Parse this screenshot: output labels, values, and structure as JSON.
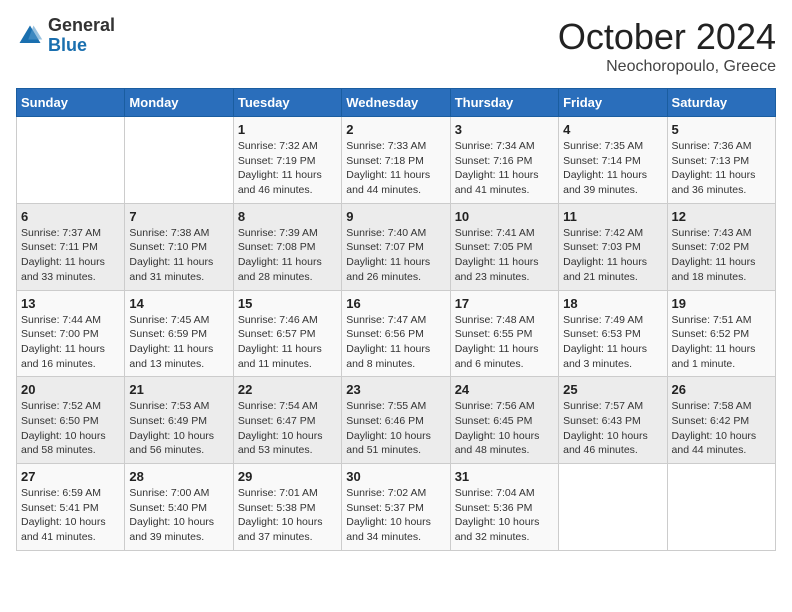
{
  "header": {
    "logo_general": "General",
    "logo_blue": "Blue",
    "month": "October 2024",
    "location": "Neochoropoulo, Greece"
  },
  "weekdays": [
    "Sunday",
    "Monday",
    "Tuesday",
    "Wednesday",
    "Thursday",
    "Friday",
    "Saturday"
  ],
  "weeks": [
    [
      {
        "day": "",
        "info": ""
      },
      {
        "day": "",
        "info": ""
      },
      {
        "day": "1",
        "info": "Sunrise: 7:32 AM\nSunset: 7:19 PM\nDaylight: 11 hours and 46 minutes."
      },
      {
        "day": "2",
        "info": "Sunrise: 7:33 AM\nSunset: 7:18 PM\nDaylight: 11 hours and 44 minutes."
      },
      {
        "day": "3",
        "info": "Sunrise: 7:34 AM\nSunset: 7:16 PM\nDaylight: 11 hours and 41 minutes."
      },
      {
        "day": "4",
        "info": "Sunrise: 7:35 AM\nSunset: 7:14 PM\nDaylight: 11 hours and 39 minutes."
      },
      {
        "day": "5",
        "info": "Sunrise: 7:36 AM\nSunset: 7:13 PM\nDaylight: 11 hours and 36 minutes."
      }
    ],
    [
      {
        "day": "6",
        "info": "Sunrise: 7:37 AM\nSunset: 7:11 PM\nDaylight: 11 hours and 33 minutes."
      },
      {
        "day": "7",
        "info": "Sunrise: 7:38 AM\nSunset: 7:10 PM\nDaylight: 11 hours and 31 minutes."
      },
      {
        "day": "8",
        "info": "Sunrise: 7:39 AM\nSunset: 7:08 PM\nDaylight: 11 hours and 28 minutes."
      },
      {
        "day": "9",
        "info": "Sunrise: 7:40 AM\nSunset: 7:07 PM\nDaylight: 11 hours and 26 minutes."
      },
      {
        "day": "10",
        "info": "Sunrise: 7:41 AM\nSunset: 7:05 PM\nDaylight: 11 hours and 23 minutes."
      },
      {
        "day": "11",
        "info": "Sunrise: 7:42 AM\nSunset: 7:03 PM\nDaylight: 11 hours and 21 minutes."
      },
      {
        "day": "12",
        "info": "Sunrise: 7:43 AM\nSunset: 7:02 PM\nDaylight: 11 hours and 18 minutes."
      }
    ],
    [
      {
        "day": "13",
        "info": "Sunrise: 7:44 AM\nSunset: 7:00 PM\nDaylight: 11 hours and 16 minutes."
      },
      {
        "day": "14",
        "info": "Sunrise: 7:45 AM\nSunset: 6:59 PM\nDaylight: 11 hours and 13 minutes."
      },
      {
        "day": "15",
        "info": "Sunrise: 7:46 AM\nSunset: 6:57 PM\nDaylight: 11 hours and 11 minutes."
      },
      {
        "day": "16",
        "info": "Sunrise: 7:47 AM\nSunset: 6:56 PM\nDaylight: 11 hours and 8 minutes."
      },
      {
        "day": "17",
        "info": "Sunrise: 7:48 AM\nSunset: 6:55 PM\nDaylight: 11 hours and 6 minutes."
      },
      {
        "day": "18",
        "info": "Sunrise: 7:49 AM\nSunset: 6:53 PM\nDaylight: 11 hours and 3 minutes."
      },
      {
        "day": "19",
        "info": "Sunrise: 7:51 AM\nSunset: 6:52 PM\nDaylight: 11 hours and 1 minute."
      }
    ],
    [
      {
        "day": "20",
        "info": "Sunrise: 7:52 AM\nSunset: 6:50 PM\nDaylight: 10 hours and 58 minutes."
      },
      {
        "day": "21",
        "info": "Sunrise: 7:53 AM\nSunset: 6:49 PM\nDaylight: 10 hours and 56 minutes."
      },
      {
        "day": "22",
        "info": "Sunrise: 7:54 AM\nSunset: 6:47 PM\nDaylight: 10 hours and 53 minutes."
      },
      {
        "day": "23",
        "info": "Sunrise: 7:55 AM\nSunset: 6:46 PM\nDaylight: 10 hours and 51 minutes."
      },
      {
        "day": "24",
        "info": "Sunrise: 7:56 AM\nSunset: 6:45 PM\nDaylight: 10 hours and 48 minutes."
      },
      {
        "day": "25",
        "info": "Sunrise: 7:57 AM\nSunset: 6:43 PM\nDaylight: 10 hours and 46 minutes."
      },
      {
        "day": "26",
        "info": "Sunrise: 7:58 AM\nSunset: 6:42 PM\nDaylight: 10 hours and 44 minutes."
      }
    ],
    [
      {
        "day": "27",
        "info": "Sunrise: 6:59 AM\nSunset: 5:41 PM\nDaylight: 10 hours and 41 minutes."
      },
      {
        "day": "28",
        "info": "Sunrise: 7:00 AM\nSunset: 5:40 PM\nDaylight: 10 hours and 39 minutes."
      },
      {
        "day": "29",
        "info": "Sunrise: 7:01 AM\nSunset: 5:38 PM\nDaylight: 10 hours and 37 minutes."
      },
      {
        "day": "30",
        "info": "Sunrise: 7:02 AM\nSunset: 5:37 PM\nDaylight: 10 hours and 34 minutes."
      },
      {
        "day": "31",
        "info": "Sunrise: 7:04 AM\nSunset: 5:36 PM\nDaylight: 10 hours and 32 minutes."
      },
      {
        "day": "",
        "info": ""
      },
      {
        "day": "",
        "info": ""
      }
    ]
  ]
}
